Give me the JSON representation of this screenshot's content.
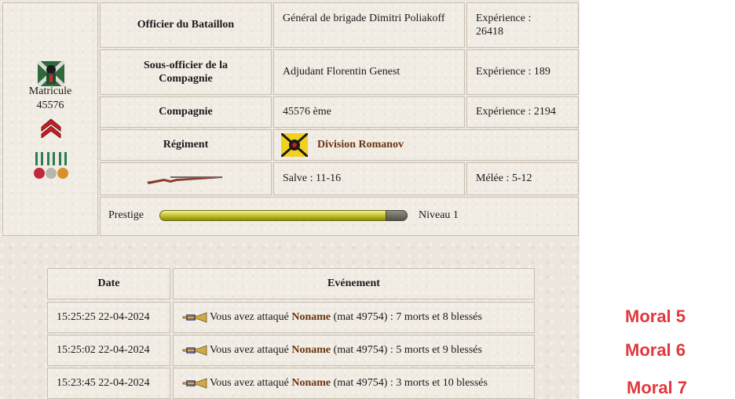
{
  "soldier": {
    "matricule_label": "Matricule",
    "matricule_number": "45576"
  },
  "officers": {
    "bataillon_header": "Officier du Bataillon",
    "bataillon_name": "Général de brigade Dimitri Poliakoff",
    "bataillon_xp": "Expérience : 26418",
    "compagnie_officer_header": "Sous-officier de la Compagnie",
    "compagnie_officer_name": "Adjudant Florentin Genest",
    "compagnie_officer_xp": "Expérience : 189",
    "compagnie_header": "Compagnie",
    "compagnie_name": "45576 ème",
    "compagnie_xp": "Expérience : 2194",
    "regiment_header": "Régiment",
    "regiment_name": "Division Romanov"
  },
  "weapon": {
    "salve": "Salve : 11-16",
    "melee": "Mélée : 5-12"
  },
  "prestige": {
    "label": "Prestige",
    "level": "Niveau 1",
    "progress_fraction": 0.91
  },
  "events": {
    "headers": [
      "Date",
      "Evénement"
    ],
    "rows": [
      {
        "date": "15:25:25 22-04-2024",
        "prefix": "Vous avez attaqué",
        "target": "Noname",
        "suffix": "(mat 49754) : 7 morts et 8 blessés"
      },
      {
        "date": "15:25:02 22-04-2024",
        "prefix": "Vous avez attaqué",
        "target": "Noname",
        "suffix": "(mat 49754) : 5 morts et 9 blessés"
      },
      {
        "date": "15:23:45 22-04-2024",
        "prefix": "Vous avez attaqué",
        "target": "Noname",
        "suffix": "(mat 49754) : 3 morts et 10 blessés"
      }
    ]
  },
  "annotations": [
    "Moral 5",
    "Moral 6",
    "Moral 7"
  ],
  "colors": {
    "accent_red": "#e0383e",
    "link_brown": "#6b3410"
  },
  "icons": [
    "soldier-portrait-icon",
    "sergeant-chevron-icon",
    "medals-icon",
    "regiment-flag-icon",
    "musket-icon",
    "bugle-icon"
  ]
}
